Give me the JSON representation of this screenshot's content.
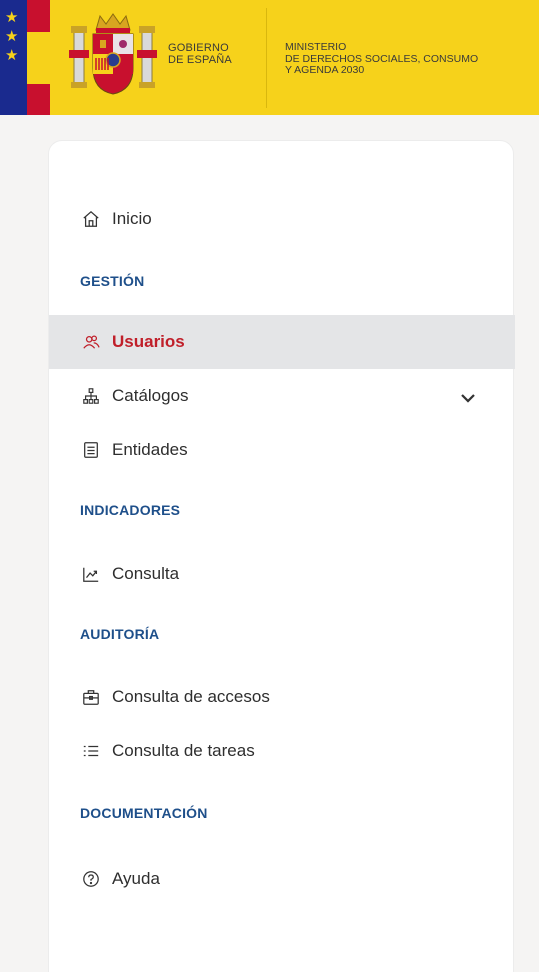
{
  "header": {
    "gov_line1": "GOBIERNO",
    "gov_line2": "DE ESPAÑA",
    "ministry_line1": "MINISTERIO",
    "ministry_line2": "DE DERECHOS SOCIALES, CONSUMO",
    "ministry_line3": "Y AGENDA 2030",
    "colors": {
      "yellow": "#f6d21b",
      "blue": "#1a2a8e",
      "red": "#c8102e"
    }
  },
  "nav": {
    "inicio": "Inicio",
    "section_gestion": "GESTIÓN",
    "usuarios": "Usuarios",
    "catalogos": "Catálogos",
    "entidades": "Entidades",
    "section_indicadores": "INDICADORES",
    "consulta": "Consulta",
    "section_auditoria": "AUDITORÍA",
    "consulta_accesos": "Consulta de accesos",
    "consulta_tareas": "Consulta de tareas",
    "section_documentacion": "DOCUMENTACIÓN",
    "ayuda": "Ayuda",
    "active_item": "Usuarios",
    "colors": {
      "active_text": "#c01f2a",
      "active_bg": "#e4e5e7",
      "section": "#1e4f8a"
    }
  },
  "icons": [
    "home-icon",
    "users-icon",
    "hierarchy-icon",
    "document-icon",
    "chart-icon",
    "briefcase-icon",
    "list-icon",
    "help-icon",
    "chevron-down-icon"
  ]
}
